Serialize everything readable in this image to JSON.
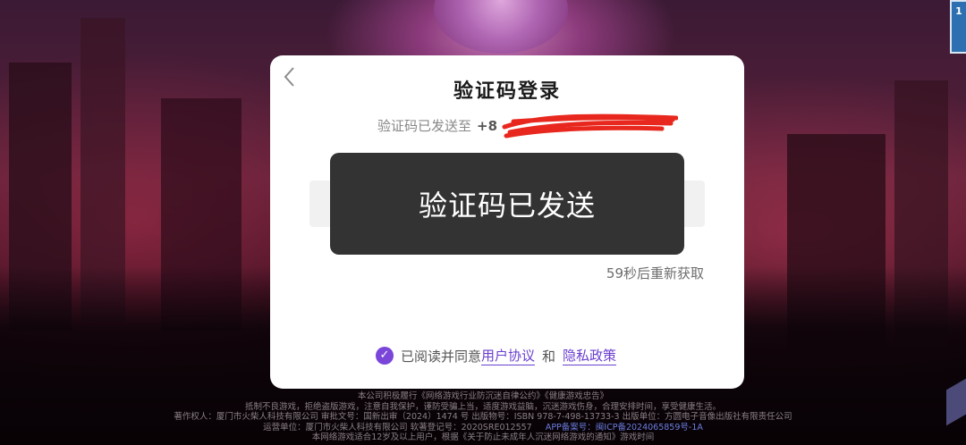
{
  "dialog": {
    "title": "验证码登录",
    "sent_prefix": "验证码已发送至",
    "phone_visible": "+8",
    "code_boxes": 6,
    "resend_text": "59秒后重新获取",
    "agreement": {
      "prefix": "已阅读并同意",
      "user_agreement": "用户协议",
      "conjunction": "和",
      "privacy_policy": "隐私政策",
      "checked": true
    }
  },
  "toast": {
    "text": "验证码已发送"
  },
  "footer": {
    "line1": "本公司积极履行《网络游戏行业防沉迷自律公约》《健康游戏忠告》",
    "line2": "抵制不良游戏，拒绝盗版游戏，注意自我保护，谨防受骗上当，适度游戏益脑，沉迷游戏伤身，合理安排时间，享受健康生活。",
    "line3": "著作权人：厦门市火柴人科技有限公司      审批文号：国新出审（2024）1474 号      出版物号：ISBN 978-7-498-13733-3      出版单位：方圆电子音像出版社有限责任公司",
    "line4_a": "运营单位：厦门市火柴人科技有限公司      软著登记号：2020SRE012557",
    "line4_b": "APP备案号：闽ICP备2024065859号-1A",
    "line5": "本网络游戏适合12岁及以上用户，根据《关于防止未成年人沉迷网络游戏的通知》游戏时间"
  },
  "colors": {
    "accent": "#7a45d9",
    "link": "#6a3fcf",
    "toast_bg": "#282828",
    "redaction": "#e8281e"
  },
  "icons": {
    "back": "chevron-left-icon",
    "check": "check-circle-icon"
  }
}
